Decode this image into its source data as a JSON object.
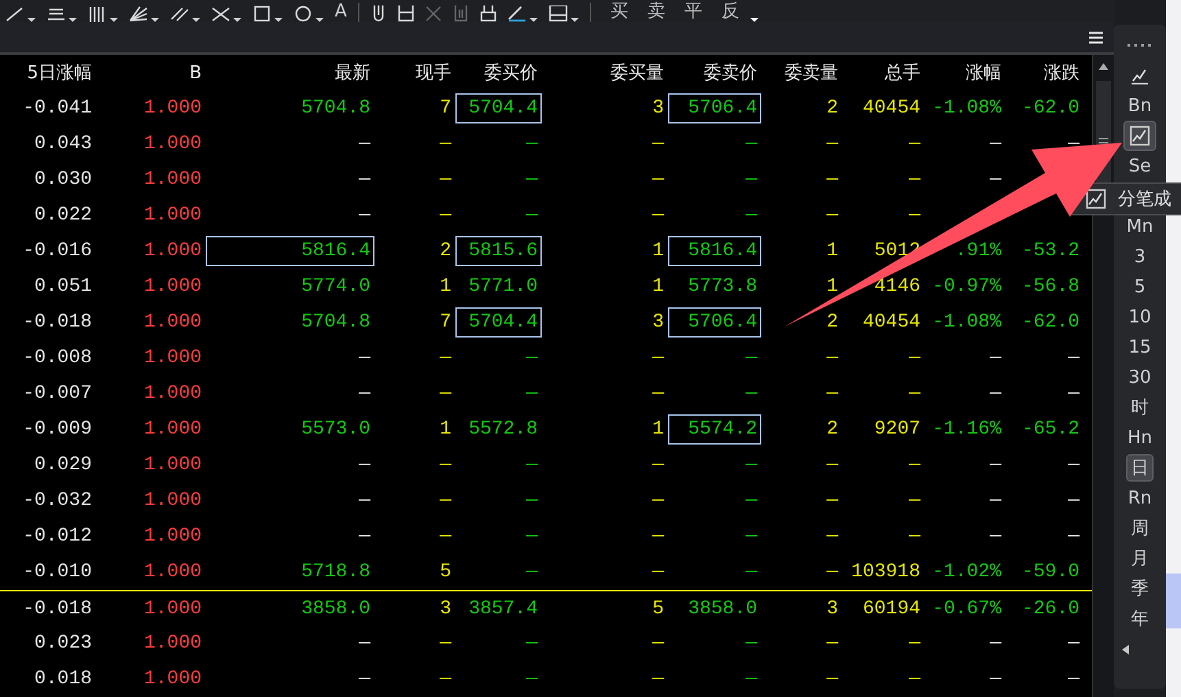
{
  "toolbar": {
    "text_tool": "A",
    "order_buttons": [
      "买",
      "卖",
      "平",
      "反"
    ]
  },
  "table": {
    "columns": [
      {
        "label": "5日涨幅",
        "kind": "plain"
      },
      {
        "label": "B",
        "kind": "ratio"
      },
      {
        "label": "最新",
        "kind": "last"
      },
      {
        "label": "现手",
        "kind": "vol"
      },
      {
        "label": "委买价",
        "kind": "bid"
      },
      {
        "label": "委买量",
        "kind": "vol"
      },
      {
        "label": "委卖价",
        "kind": "bid"
      },
      {
        "label": "委卖量",
        "kind": "vol"
      },
      {
        "label": "总手",
        "kind": "vol"
      },
      {
        "label": "涨幅",
        "kind": "change"
      },
      {
        "label": "涨跌",
        "kind": "change"
      }
    ],
    "rows": [
      {
        "quoted": true,
        "divider_above": false,
        "cells": [
          "-0.041",
          "1.000",
          "5704.8",
          "7",
          {
            "text": "5704.4",
            "boxed": true
          },
          "3",
          {
            "text": "5706.4",
            "boxed": true
          },
          "2",
          "40454",
          "-1.08%",
          "-62.0"
        ]
      },
      {
        "quoted": false,
        "divider_above": false,
        "cells": [
          "0.043",
          "1.000",
          "—",
          "—",
          "—",
          "—",
          "—",
          "—",
          "—",
          "—",
          "—"
        ]
      },
      {
        "quoted": false,
        "divider_above": false,
        "cells": [
          "0.030",
          "1.000",
          "—",
          "—",
          "—",
          "—",
          "—",
          "—",
          "—",
          "—"
        ]
      },
      {
        "quoted": false,
        "divider_above": false,
        "cells": [
          "0.022",
          "1.000",
          "—",
          "—",
          "—",
          "—",
          "—",
          "—",
          "—"
        ]
      },
      {
        "quoted": true,
        "divider_above": false,
        "cells": [
          "-0.016",
          "1.000",
          {
            "text": "5816.4",
            "boxed": true
          },
          "2",
          {
            "text": "5815.6",
            "boxed": true
          },
          "1",
          {
            "text": "5816.4",
            "boxed": true
          },
          "1",
          "5012",
          ".91%",
          "-53.2"
        ]
      },
      {
        "quoted": true,
        "divider_above": false,
        "cells": [
          "0.051",
          "1.000",
          "5774.0",
          "1",
          "5771.0",
          "1",
          "5773.8",
          "1",
          "4146",
          "-0.97%",
          "-56.8"
        ]
      },
      {
        "quoted": true,
        "divider_above": false,
        "cells": [
          "-0.018",
          "1.000",
          "5704.8",
          "7",
          {
            "text": "5704.4",
            "boxed": true
          },
          "3",
          {
            "text": "5706.4",
            "boxed": true
          },
          "2",
          "40454",
          "-1.08%",
          "-62.0"
        ]
      },
      {
        "quoted": false,
        "divider_above": false,
        "cells": [
          "-0.008",
          "1.000",
          "—",
          "—",
          "—",
          "—",
          "—",
          "—",
          "—",
          "—",
          "—"
        ]
      },
      {
        "quoted": false,
        "divider_above": false,
        "cells": [
          "-0.007",
          "1.000",
          "—",
          "—",
          "—",
          "—",
          "—",
          "—",
          "—",
          "—",
          "—"
        ]
      },
      {
        "quoted": true,
        "divider_above": false,
        "cells": [
          "-0.009",
          "1.000",
          "5573.0",
          "1",
          "5572.8",
          "1",
          {
            "text": "5574.2",
            "boxed": true
          },
          "2",
          "9207",
          "-1.16%",
          "-65.2"
        ]
      },
      {
        "quoted": false,
        "divider_above": false,
        "cells": [
          "0.029",
          "1.000",
          "—",
          "—",
          "—",
          "—",
          "—",
          "—",
          "—",
          "—",
          "—"
        ]
      },
      {
        "quoted": false,
        "divider_above": false,
        "cells": [
          "-0.032",
          "1.000",
          "—",
          "—",
          "—",
          "—",
          "—",
          "—",
          "—",
          "—",
          "—"
        ]
      },
      {
        "quoted": false,
        "divider_above": false,
        "cells": [
          "-0.012",
          "1.000",
          "—",
          "—",
          "—",
          "—",
          "—",
          "—",
          "—",
          "—",
          "—"
        ]
      },
      {
        "quoted": true,
        "divider_above": false,
        "cells": [
          "-0.010",
          "1.000",
          "5718.8",
          "5",
          "—",
          "—",
          "—",
          "—",
          "103918",
          "-1.02%",
          "-59.0"
        ]
      },
      {
        "quoted": true,
        "divider_above": true,
        "cells": [
          "-0.018",
          "1.000",
          "3858.0",
          "3",
          "3857.4",
          "5",
          "3858.0",
          "3",
          "60194",
          "-0.67%",
          "-26.0"
        ]
      },
      {
        "quoted": false,
        "divider_above": false,
        "cells": [
          "0.023",
          "1.000",
          "—",
          "—",
          "—",
          "—",
          "—",
          "—",
          "—",
          "—",
          "—"
        ]
      },
      {
        "quoted": false,
        "divider_above": false,
        "cells": [
          "0.018",
          "1.000",
          "—",
          "—",
          "—",
          "—",
          "—",
          "—",
          "—",
          "—",
          "—"
        ]
      }
    ]
  },
  "sidebar": {
    "items": [
      {
        "kind": "dots"
      },
      {
        "kind": "chart",
        "selected": false
      },
      {
        "kind": "text",
        "label": "Bn",
        "selected": false
      },
      {
        "kind": "chart",
        "selected": true
      },
      {
        "kind": "text",
        "label": "Se",
        "selected": false
      },
      {
        "kind": "tooltip",
        "label": "分笔成"
      },
      {
        "kind": "text",
        "label": "Mn",
        "selected": false
      },
      {
        "kind": "text",
        "label": "3",
        "selected": false
      },
      {
        "kind": "text",
        "label": "5",
        "selected": false
      },
      {
        "kind": "text",
        "label": "10",
        "selected": false
      },
      {
        "kind": "text",
        "label": "15",
        "selected": false
      },
      {
        "kind": "text",
        "label": "30",
        "selected": false
      },
      {
        "kind": "text",
        "label": "时",
        "selected": false
      },
      {
        "kind": "text",
        "label": "Hn",
        "selected": false
      },
      {
        "kind": "text",
        "label": "日",
        "selected": true
      },
      {
        "kind": "text",
        "label": "Rn",
        "selected": false
      },
      {
        "kind": "text",
        "label": "周",
        "selected": false
      },
      {
        "kind": "text",
        "label": "月",
        "selected": false
      },
      {
        "kind": "text",
        "label": "季",
        "selected": false
      },
      {
        "kind": "text",
        "label": "年",
        "selected": false
      },
      {
        "kind": "collapse"
      }
    ]
  }
}
